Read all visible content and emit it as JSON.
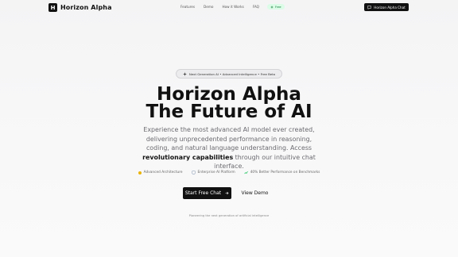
{
  "nav": {
    "logo_letter": "H",
    "brand": "Horizon Alpha",
    "links": [
      "Features",
      "Demo",
      "How it Works",
      "FAQ"
    ],
    "free_badge": "Free",
    "chat_button": "Horizon Alpha Chat"
  },
  "hero": {
    "badge": "Next Generation AI • Advanced Intelligence • Free Beta",
    "title_line1": "Horizon Alpha",
    "title_line2": "The Future of AI",
    "lead_part1": "Experience the most advanced AI model ever created, delivering unprecedented performance in reasoning, coding, and natural language understanding. Access ",
    "lead_bold": "revolutionary capabilities",
    "lead_part2": " through our intuitive chat interface.",
    "features": [
      {
        "label": "Advanced Architecture",
        "color": "#eab308"
      },
      {
        "label": "Enterprise AI Platform",
        "color": "#94a3b8"
      },
      {
        "label": "40% Better Performance on Benchmarks",
        "color": "#22c55e"
      }
    ],
    "primary_button": "Start Free Chat",
    "secondary_button": "View Demo",
    "footnote": "Pioneering the next generation of artificial intelligence"
  },
  "colors": {
    "accent": "#111111",
    "free_bg": "#dcfce7",
    "free_text": "#15803d"
  }
}
